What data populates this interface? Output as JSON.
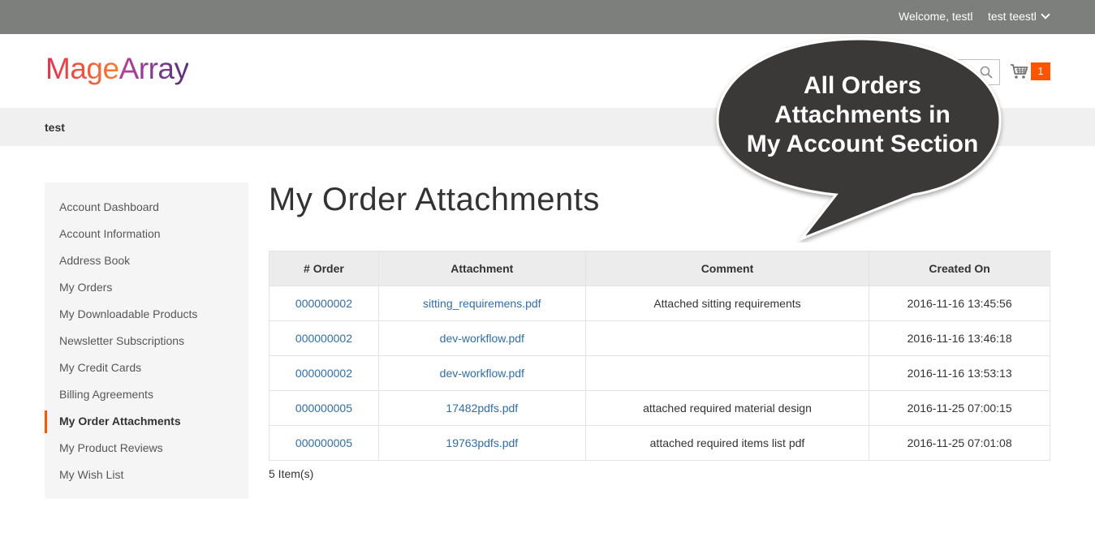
{
  "topbar": {
    "welcome": "Welcome, testl",
    "user_name": "test teestl"
  },
  "header": {
    "logo_part1": "Mage",
    "logo_part2": "Array",
    "cart_count": "1",
    "search_placeholder": ""
  },
  "titlebar": {
    "name": "test"
  },
  "sidebar": {
    "items": [
      {
        "label": "Account Dashboard"
      },
      {
        "label": "Account Information"
      },
      {
        "label": "Address Book"
      },
      {
        "label": "My Orders"
      },
      {
        "label": "My Downloadable Products"
      },
      {
        "label": "Newsletter Subscriptions"
      },
      {
        "label": "My Credit Cards"
      },
      {
        "label": "Billing Agreements"
      },
      {
        "label": "My Order Attachments",
        "active": true
      },
      {
        "label": "My Product Reviews"
      },
      {
        "label": "My Wish List"
      }
    ]
  },
  "main": {
    "title": "My Order Attachments",
    "columns": [
      "# Order",
      "Attachment",
      "Comment",
      "Created On"
    ],
    "rows": [
      {
        "order": "000000002",
        "attachment": "sitting_requiremens.pdf",
        "comment": "Attached sitting requirements",
        "created": "2016-11-16 13:45:56"
      },
      {
        "order": "000000002",
        "attachment": "dev-workflow.pdf",
        "comment": "",
        "created": "2016-11-16 13:46:18"
      },
      {
        "order": "000000002",
        "attachment": "dev-workflow.pdf",
        "comment": "",
        "created": "2016-11-16 13:53:13"
      },
      {
        "order": "000000005",
        "attachment": "17482pdfs.pdf",
        "comment": "attached required material design",
        "created": "2016-11-25 07:00:15"
      },
      {
        "order": "000000005",
        "attachment": "19763pdfs.pdf",
        "comment": "attached required items list pdf",
        "created": "2016-11-25 07:01:08"
      }
    ],
    "item_count": "5 Item(s)"
  },
  "callout": {
    "line1": "All Orders",
    "line2": "Attachments in",
    "line3": "My Account Section"
  },
  "colors": {
    "accent": "#ff5501",
    "link": "#2f6eab",
    "topbar": "#7d7f7c",
    "callout": "#3b3837"
  }
}
